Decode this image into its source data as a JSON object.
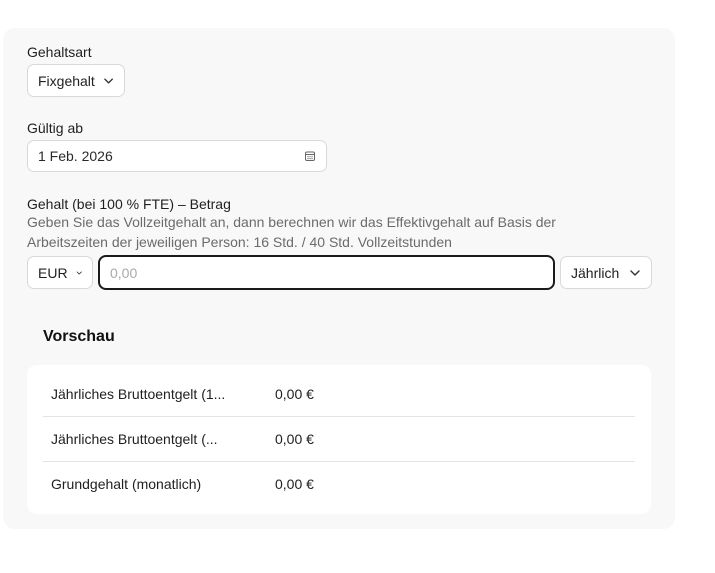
{
  "salary_type": {
    "label": "Gehaltsart",
    "value": "Fixgehalt"
  },
  "valid_from": {
    "label": "Gültig ab",
    "value": "1 Feb. 2026"
  },
  "salary_amount": {
    "label": "Gehalt (bei 100 % FTE) – Betrag",
    "help_line1": "Geben Sie das Vollzeitgehalt an, dann berechnen wir das Effektivgehalt auf Basis der",
    "help_line2": "Arbeitszeiten der jeweiligen Person: 16 Std. / 40 Std. Vollzeitstunden",
    "currency": "EUR",
    "placeholder": "0,00",
    "value": "",
    "frequency": "Jährlich"
  },
  "preview": {
    "title": "Vorschau",
    "rows": [
      {
        "label": "Jährliches Bruttoentgelt (1...",
        "value": "0,00 €"
      },
      {
        "label": "Jährliches Bruttoentgelt (...",
        "value": "0,00 €"
      },
      {
        "label": "Grundgehalt (monatlich)",
        "value": "0,00 €"
      }
    ]
  },
  "colors": {
    "card_bg": "#f8f8f8",
    "focus_border": "#1a1a1a",
    "muted_text": "#6b6b6b"
  }
}
